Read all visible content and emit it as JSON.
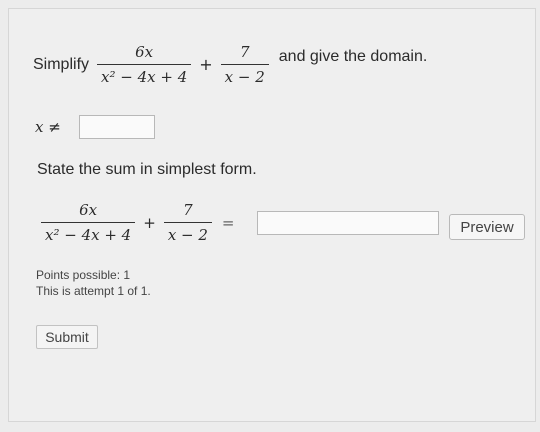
{
  "question": {
    "prefix": "Simplify",
    "frac1": {
      "num": "6x",
      "den": "x² − 4x + 4"
    },
    "plus": "+",
    "frac2": {
      "num": "7",
      "den": "x − 2"
    },
    "suffix": "and give the domain."
  },
  "domain": {
    "label": "x ≠",
    "value": ""
  },
  "sum_prompt": "State the sum in simplest form.",
  "sum": {
    "frac1": {
      "num": "6x",
      "den": "x² − 4x + 4"
    },
    "plus": "+",
    "frac2": {
      "num": "7",
      "den": "x − 2"
    },
    "equals": "=",
    "answer_value": ""
  },
  "preview_label": "Preview",
  "points_possible": "Points possible: 1",
  "attempt_text": "This is attempt 1 of 1.",
  "submit_label": "Submit"
}
